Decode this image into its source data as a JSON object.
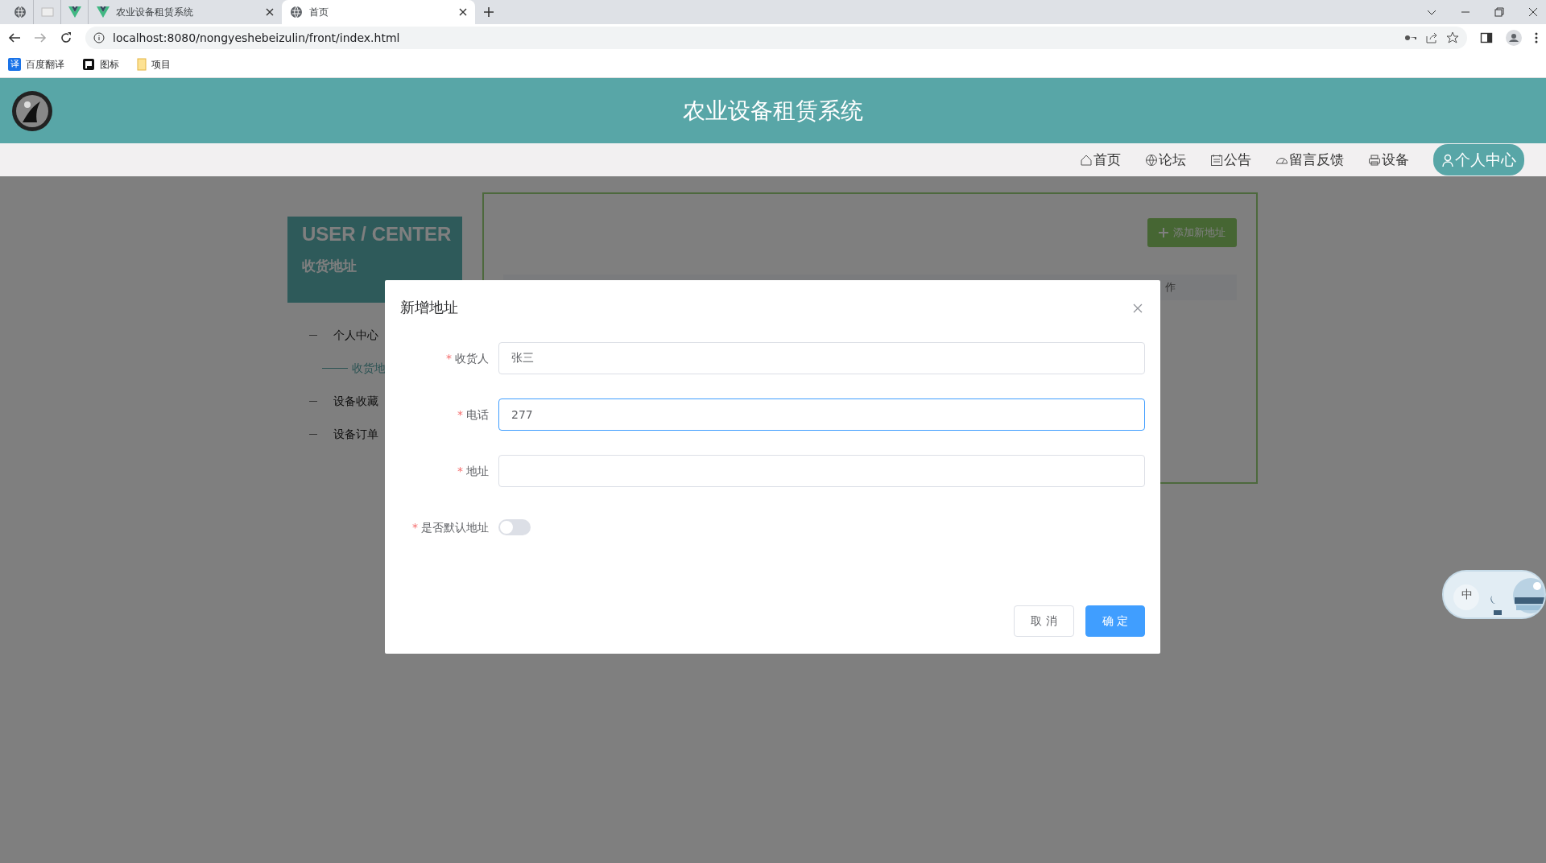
{
  "browser": {
    "tabs": [
      {
        "kind": "pinned-globe",
        "selected": false
      },
      {
        "kind": "pinned-page",
        "selected": false
      },
      {
        "kind": "pinned-v",
        "selected": false
      },
      {
        "kind": "v",
        "title": "农业设备租赁系统",
        "selected": false
      },
      {
        "kind": "globe",
        "title": "首页",
        "selected": true
      }
    ],
    "url": "localhost:8080/nongyeshebeizulin/front/index.html",
    "bookmarks": [
      {
        "kind": "translate",
        "badge": "译",
        "label": "百度翻译"
      },
      {
        "kind": "flag",
        "label": "图标"
      },
      {
        "kind": "folder",
        "label": "项目"
      }
    ]
  },
  "site": {
    "title": "农业设备租赁系统",
    "nav": [
      {
        "kind": "home",
        "label": "首页",
        "selected": false
      },
      {
        "kind": "globe",
        "label": "论坛",
        "selected": false
      },
      {
        "kind": "calendar",
        "label": "公告",
        "selected": false
      },
      {
        "kind": "gauge",
        "label": "留言反馈",
        "selected": false
      },
      {
        "kind": "printer",
        "label": "设备",
        "selected": false
      },
      {
        "kind": "user",
        "label": "个人中心",
        "selected": true
      }
    ]
  },
  "sidebar": {
    "heading": "USER / CENTER",
    "subheading": "收货地址",
    "items": [
      {
        "label": "个人中心",
        "selected": false,
        "children": [
          {
            "label": "收货地",
            "selected": true
          }
        ]
      },
      {
        "label": "设备收藏",
        "selected": false
      },
      {
        "label": "设备订单",
        "selected": false
      }
    ]
  },
  "panel": {
    "add_button": "添加新地址",
    "table": {
      "columns": [
        "作"
      ]
    }
  },
  "dialog": {
    "title": "新增地址",
    "fields": [
      {
        "kind": "text",
        "marker": "*",
        "label": "收货人",
        "value": "张三",
        "focused": false
      },
      {
        "kind": "text",
        "marker": "*",
        "label": "电话",
        "value": "277",
        "focused": true
      },
      {
        "kind": "text",
        "marker": "*",
        "label": "地址",
        "focused": false
      },
      {
        "kind": "switch",
        "marker": "*",
        "label": "是否默认地址",
        "checked": false
      }
    ],
    "buttons": [
      {
        "kind": "default",
        "label": "取 消"
      },
      {
        "kind": "primary",
        "label": "确 定"
      }
    ]
  },
  "widget": {
    "label": "中"
  }
}
